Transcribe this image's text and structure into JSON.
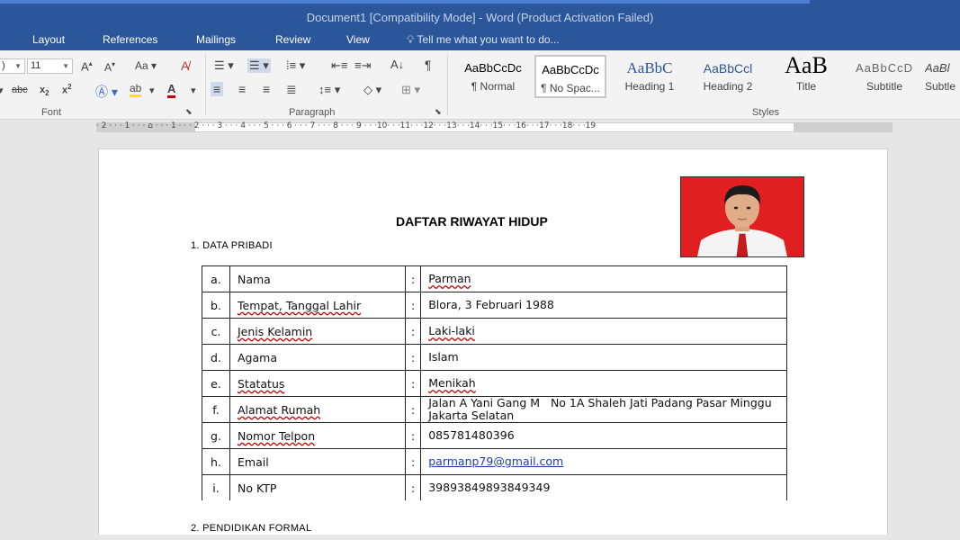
{
  "window": {
    "title": "Document1 [Compatibility Mode] - Word (Product Activation Failed)"
  },
  "tabs": [
    "Layout",
    "References",
    "Mailings",
    "Review",
    "View"
  ],
  "tell_me": "Tell me what you want to do...",
  "font_group": {
    "label": "Font",
    "font_size": "11",
    "font_name_tail": ")"
  },
  "paragraph_group": {
    "label": "Paragraph"
  },
  "styles_group": {
    "label": "Styles",
    "items": [
      {
        "preview": "AaBbCcDc",
        "name": "¶ Normal"
      },
      {
        "preview": "AaBbCcDc",
        "name": "¶ No Spac..."
      },
      {
        "preview": "AaBbC",
        "name": "Heading 1"
      },
      {
        "preview": "AaBbCcl",
        "name": "Heading 2"
      },
      {
        "preview": "AaB",
        "name": "Title"
      },
      {
        "preview": "AaBbCcD",
        "name": "Subtitle"
      },
      {
        "preview": "AaBl",
        "name": "Subtle"
      }
    ]
  },
  "ruler": {
    "text": "· 2 · · · 1 · · · ⌂ · · · 1 · · · 2 · · · 3 · · · 4 · · · 5 · · · 6 · · · 7 · · · 8 · · · 9 · · ·10· · ·11· · ·12· · ·13· · ·14· · ·15· · ·16· · ·17· · ·18· · ·19"
  },
  "document": {
    "title": "DAFTAR RIWAYAT HIDUP",
    "section1": "1.  DATA PRIBADI",
    "section2": "2.  PENDIDIKAN FORMAL",
    "rows": [
      {
        "key": "a.",
        "label": "Nama",
        "sep": ":",
        "value": "Parman"
      },
      {
        "key": "b.",
        "label": "Tempat, Tanggal Lahir",
        "sep": ":",
        "value": "Blora, 3 Februari 1988"
      },
      {
        "key": "c.",
        "label": "Jenis Kelamin",
        "sep": ":",
        "value": "Laki-laki"
      },
      {
        "key": "d.",
        "label": "Agama",
        "sep": ":",
        "value": "Islam"
      },
      {
        "key": "e.",
        "label": "Statatus",
        "sep": ":",
        "value": "Menikah"
      },
      {
        "key": "f.",
        "label": "Alamat Rumah",
        "sep": ":",
        "value": "Jalan A Yani Gang M   No 1A Shaleh Jati Padang Pasar Minggu Jakarta Selatan"
      },
      {
        "key": "g.",
        "label": "Nomor Telpon",
        "sep": ":",
        "value": "085781480396"
      },
      {
        "key": "h.",
        "label": "Email",
        "sep": ":",
        "value": "parmanp79@gmail.com"
      },
      {
        "key": "i.",
        "label": "No KTP",
        "sep": ":",
        "value": "39893849893849349"
      }
    ]
  },
  "colors": {
    "titlebar": "#2b579a",
    "ribbon": "#f3f3f3",
    "photo_bg": "#e02020"
  },
  "icons": [
    "bullets-icon",
    "numbering-icon",
    "multilevel-list-icon",
    "decrease-indent-icon",
    "increase-indent-icon",
    "sort-icon",
    "pilcrow-icon",
    "align-left-icon",
    "center-icon",
    "align-right-icon",
    "justify-icon",
    "line-spacing-icon",
    "shading-icon",
    "borders-icon",
    "grow-font-icon",
    "shrink-font-icon",
    "change-case-icon",
    "clear-format-icon",
    "strikethrough-icon",
    "subscript-icon",
    "superscript-icon",
    "text-effects-icon",
    "highlight-icon",
    "font-color-icon"
  ]
}
